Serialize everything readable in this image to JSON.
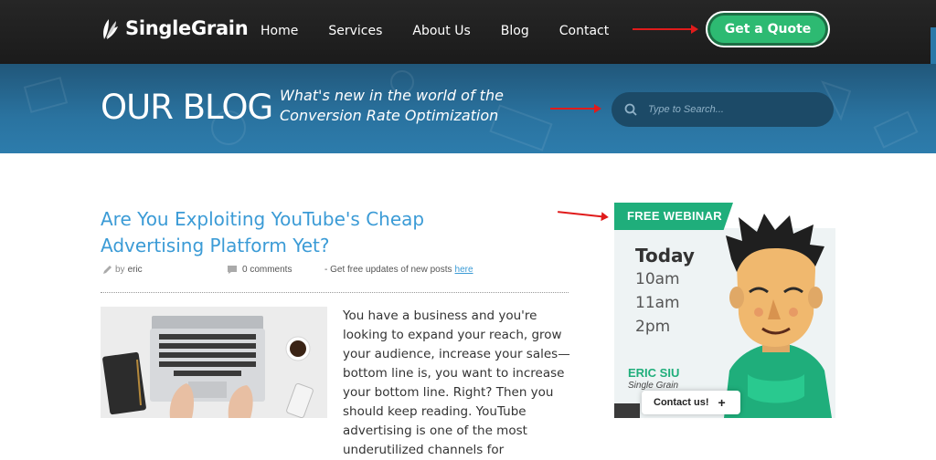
{
  "header": {
    "logo_text": "SingleGrain",
    "nav": [
      "Home",
      "Services",
      "About Us",
      "Blog",
      "Contact"
    ],
    "cta_label": "Get a Quote"
  },
  "banner": {
    "title": "OUR BLOG",
    "subtitle": "What's new in the world of the Conversion Rate Optimization",
    "search_placeholder": "Type to Search..."
  },
  "post": {
    "title": "Are You Exploiting YouTube's Cheap Advertising Platform Yet?",
    "author_prefix": "by",
    "author": "eric",
    "comments": "0 comments",
    "updates_text": "- Get free updates of new posts",
    "updates_link": "here",
    "body": "You have a business and you're looking to expand your reach, grow your audience, increase your sales—bottom line is, you want to increase your bottom line. Right? Then you should keep reading. YouTube advertising is one of the most underutilized channels for"
  },
  "sidebar": {
    "tag": "FREE WEBINAR",
    "day": "Today",
    "times": [
      "10am",
      "11am",
      "2pm"
    ],
    "presenter": "ERIC SIU",
    "company": "Single Grain"
  },
  "contact_widget": {
    "label": "Contact us!",
    "icon": "plus-icon"
  },
  "colors": {
    "accent_green": "#2dba72",
    "link_blue": "#3b9bd6",
    "banner_blue": "#2a73a0",
    "annotation_red": "#e01b1b"
  }
}
